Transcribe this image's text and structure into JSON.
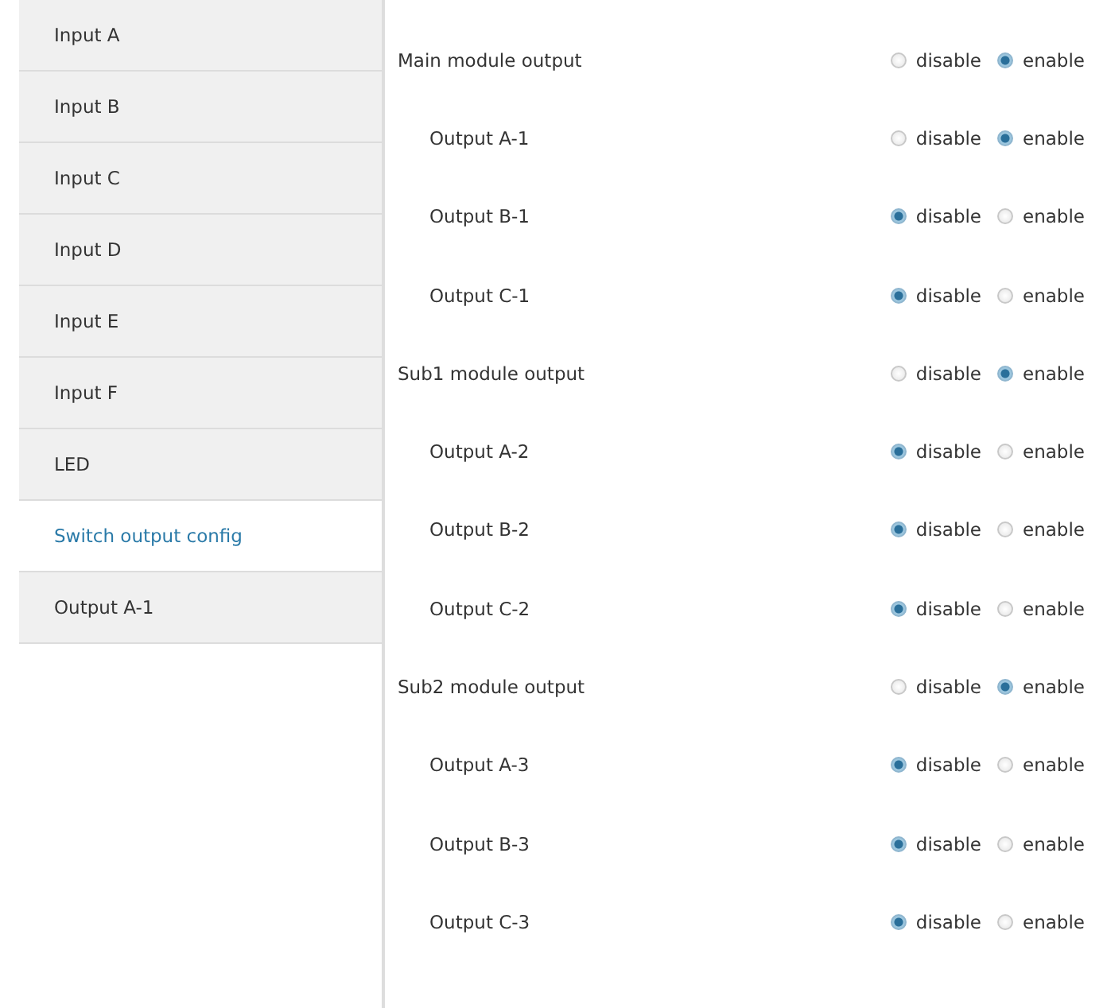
{
  "sidebar": {
    "items": [
      {
        "label": "Input A",
        "selected": false
      },
      {
        "label": "Input B",
        "selected": false
      },
      {
        "label": "Input C",
        "selected": false
      },
      {
        "label": "Input D",
        "selected": false
      },
      {
        "label": "Input E",
        "selected": false
      },
      {
        "label": "Input F",
        "selected": false
      },
      {
        "label": "LED",
        "selected": false
      },
      {
        "label": "Switch output config",
        "selected": true
      },
      {
        "label": "Output A-1",
        "selected": false
      }
    ]
  },
  "settings": [
    {
      "kind": "module",
      "label": "Main module output",
      "options": [
        {
          "label": "disable",
          "selected": false
        },
        {
          "label": "enable",
          "selected": true
        }
      ]
    },
    {
      "kind": "output",
      "label": "Output A-1",
      "options": [
        {
          "label": "disable",
          "selected": false
        },
        {
          "label": "enable",
          "selected": true
        }
      ]
    },
    {
      "kind": "output",
      "label": "Output B-1",
      "options": [
        {
          "label": "disable",
          "selected": true
        },
        {
          "label": "enable",
          "selected": false
        }
      ]
    },
    {
      "kind": "output",
      "label": "Output C-1",
      "options": [
        {
          "label": "disable",
          "selected": true
        },
        {
          "label": "enable",
          "selected": false
        }
      ]
    },
    {
      "kind": "module",
      "label": "Sub1 module output",
      "options": [
        {
          "label": "disable",
          "selected": false
        },
        {
          "label": "enable",
          "selected": true
        }
      ]
    },
    {
      "kind": "output",
      "label": "Output A-2",
      "options": [
        {
          "label": "disable",
          "selected": true
        },
        {
          "label": "enable",
          "selected": false
        }
      ]
    },
    {
      "kind": "output",
      "label": "Output B-2",
      "options": [
        {
          "label": "disable",
          "selected": true
        },
        {
          "label": "enable",
          "selected": false
        }
      ]
    },
    {
      "kind": "output",
      "label": "Output C-2",
      "options": [
        {
          "label": "disable",
          "selected": true
        },
        {
          "label": "enable",
          "selected": false
        }
      ]
    },
    {
      "kind": "module",
      "label": "Sub2 module output",
      "options": [
        {
          "label": "disable",
          "selected": false
        },
        {
          "label": "enable",
          "selected": true
        }
      ]
    },
    {
      "kind": "output",
      "label": "Output A-3",
      "options": [
        {
          "label": "disable",
          "selected": true
        },
        {
          "label": "enable",
          "selected": false
        }
      ]
    },
    {
      "kind": "output",
      "label": "Output B-3",
      "options": [
        {
          "label": "disable",
          "selected": true
        },
        {
          "label": "enable",
          "selected": false
        }
      ]
    },
    {
      "kind": "output",
      "label": "Output C-3",
      "options": [
        {
          "label": "disable",
          "selected": true
        },
        {
          "label": "enable",
          "selected": false
        }
      ]
    }
  ]
}
